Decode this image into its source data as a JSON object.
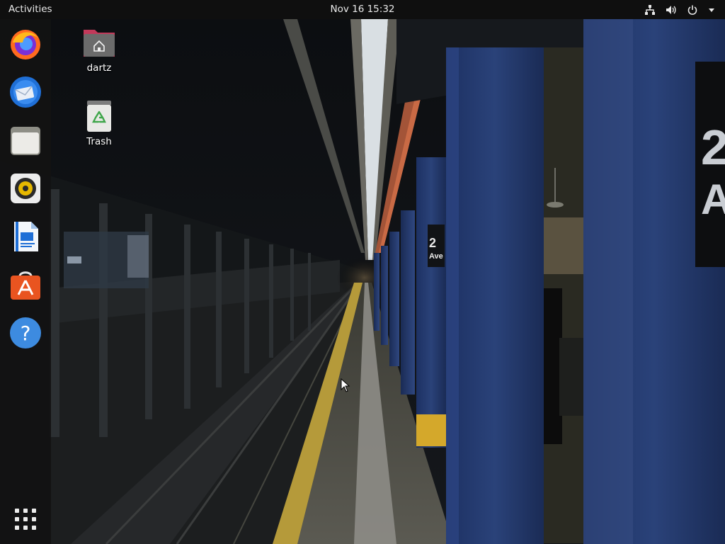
{
  "topbar": {
    "activities_label": "Activities",
    "clock": "Nov 16  15:32",
    "tray_icons": [
      "network-icon",
      "volume-icon",
      "power-icon",
      "chevron-down-icon"
    ]
  },
  "dock": {
    "apps": [
      {
        "name": "firefox",
        "icon": "firefox-icon"
      },
      {
        "name": "thunderbird",
        "icon": "thunderbird-icon"
      },
      {
        "name": "files",
        "icon": "files-icon"
      },
      {
        "name": "rhythmbox",
        "icon": "rhythmbox-icon"
      },
      {
        "name": "libreoffice-writer",
        "icon": "writer-icon"
      },
      {
        "name": "ubuntu-software",
        "icon": "software-icon"
      },
      {
        "name": "help",
        "icon": "help-icon"
      }
    ],
    "show_apps": "app-grid-icon"
  },
  "desktop": {
    "icons": [
      {
        "label": "dartz",
        "icon": "home-folder-icon"
      },
      {
        "label": "Trash",
        "icon": "trash-icon"
      }
    ]
  },
  "wallpaper": {
    "sign_top": "2",
    "sign_bottom": "Ave",
    "sign_large_a": "2",
    "sign_large_b": "A"
  },
  "colors": {
    "topbar": "#0f0f0f",
    "dock": "#121212",
    "pillar_blue": "#243a6e",
    "yellow_edge": "#c9a227"
  }
}
